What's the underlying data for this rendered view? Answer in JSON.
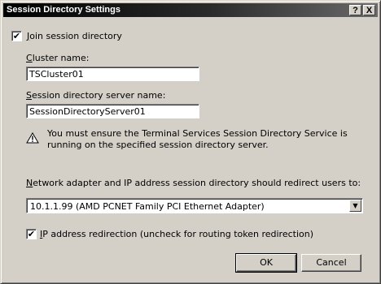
{
  "window": {
    "title": "Session Directory Settings",
    "help_glyph": "?",
    "close_glyph": "X"
  },
  "join": {
    "checked": true,
    "check_glyph": "✔",
    "label_prefix": "",
    "label_mnemonic": "J",
    "label_rest": "oin session directory"
  },
  "cluster": {
    "label_mnemonic": "C",
    "label_rest": "luster name:",
    "value": "TSCluster01"
  },
  "server": {
    "label_mnemonic": "S",
    "label_rest": "ession directory server name:",
    "value": "SessionDirectoryServer01"
  },
  "warning": {
    "icon": "warning-icon",
    "text": "You must ensure the Terminal Services Session Directory Service is running on the specified session directory server."
  },
  "network": {
    "label_mnemonic": "N",
    "label_rest": "etwork adapter and IP address session directory should redirect users to:",
    "selected": "10.1.1.99 (AMD PCNET Family PCI Ethernet Adapter)",
    "arrow_glyph": "▼"
  },
  "ipredirect": {
    "checked": true,
    "check_glyph": "✔",
    "label_mnemonic": "I",
    "label_rest": "P address redirection (uncheck for routing token redirection)"
  },
  "buttons": {
    "ok": "OK",
    "cancel": "Cancel"
  }
}
